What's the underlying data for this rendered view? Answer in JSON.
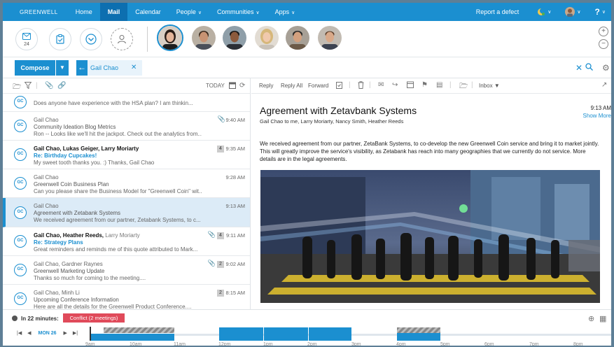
{
  "nav": {
    "brand": "GREENWELL",
    "items": [
      {
        "label": "Home",
        "active": false,
        "caret": false
      },
      {
        "label": "Mail",
        "active": true,
        "caret": false
      },
      {
        "label": "Calendar",
        "active": false,
        "caret": false
      },
      {
        "label": "People",
        "active": false,
        "caret": true
      },
      {
        "label": "Communities",
        "active": false,
        "caret": true
      },
      {
        "label": "Apps",
        "active": false,
        "caret": true
      }
    ],
    "report_defect": "Report a defect",
    "help": "?"
  },
  "toolbar": {
    "calendar_badge": "24"
  },
  "compose": {
    "label": "Compose",
    "filter_name": "Gail Chao"
  },
  "list": {
    "today_label": "TODAY",
    "messages": [
      {
        "initials": "GC",
        "from": "",
        "subject": "",
        "preview": "Does anyone have experience with the HSA plan? I am thinkin...",
        "time": "",
        "count": "",
        "attach": false,
        "unread": false,
        "selected": false
      },
      {
        "initials": "GC",
        "from": "Gail Chao",
        "from_extra": "",
        "subject": "Community Ideation Blog Metrics",
        "preview": "Ron -- Looks like we'll hit the jackpot. Check out the analytics from...",
        "time": "9:40 AM",
        "count": "",
        "attach": true,
        "unread": false,
        "selected": false
      },
      {
        "initials": "GC",
        "from": "Gail Chao, Lukas Geiger, Larry Moriarty",
        "from_extra": "",
        "subject": "Re: Birthday Cupcakes!",
        "preview": "My sweet tooth thanks you. :) Thanks, Gail Chao",
        "time": "9:35 AM",
        "count": "4",
        "attach": false,
        "unread": true,
        "selected": false
      },
      {
        "initials": "GC",
        "from": "Gail Chao",
        "from_extra": "",
        "subject": "Greenwell Coin Business Plan",
        "preview": "Can you please share the Business Model for \"Greenwell Coin\" wit...",
        "time": "9:28 AM",
        "count": "",
        "attach": false,
        "unread": false,
        "selected": false
      },
      {
        "initials": "GC",
        "from": "Gail Chao",
        "from_extra": "",
        "subject": "Agreement with Zetabank Systems",
        "preview": "We received agreement from our partner, Zetabank Systems, to c...",
        "time": "9:13 AM",
        "count": "",
        "attach": false,
        "unread": false,
        "selected": true
      },
      {
        "initials": "GC",
        "from": "Gail Chao, Heather Reeds,",
        "from_extra": " Larry Moriarty",
        "subject": "Re: Strategy Plans",
        "preview": "Great reminders and reminds me of this quote attributed to Mark...",
        "time": "9:11 AM",
        "count": "4",
        "attach": true,
        "unread": true,
        "selected": false
      },
      {
        "initials": "GC",
        "from": "Gail Chao, Gardner Raynes",
        "from_extra": "",
        "subject": "Greenwell Marketing Update",
        "preview": "Thanks so much for coming to the meeting....",
        "time": "9:02 AM",
        "count": "2",
        "attach": true,
        "unread": false,
        "selected": false
      },
      {
        "initials": "GC",
        "from": "Gail Chao, Minh Li",
        "from_extra": "",
        "subject": "Upcoming Conference Information",
        "preview": "Here are all the details for the Greenwell Product Conference....",
        "time": "8:15 AM",
        "count": "2",
        "attach": false,
        "unread": false,
        "selected": false
      }
    ]
  },
  "reader": {
    "actions": {
      "reply": "Reply",
      "reply_all": "Reply All",
      "forward": "Forward",
      "inbox": "Inbox"
    },
    "subject": "Agreement with Zetavbank Systems",
    "recipients": "Gail Chao to me, Larry Moriarty, Nancy Smith, Heather Reeds",
    "time": "9:13 AM",
    "show_more": "Show More",
    "body": "We received agreement from our partner, ZetaBank Systems, to co-develop the new Greenwell Coin service and bring it to market jointly. This will greatly improve the service's visibility, as Zetabank has reach into many geographies that we currently do not service. More details are in the legal agreements."
  },
  "calendar": {
    "upcoming": "In 22 minutes:",
    "conflict": "Conflict (2 meetings)",
    "day": "MON 26",
    "hours": [
      "9am",
      "10am",
      "11am",
      "12pm",
      "1pm",
      "2pm",
      "3pm",
      "4pm",
      "5pm",
      "6pm",
      "7pm",
      "8pm"
    ]
  },
  "colors": {
    "accent": "#1b8fd0",
    "conflict": "#e04a5a"
  }
}
